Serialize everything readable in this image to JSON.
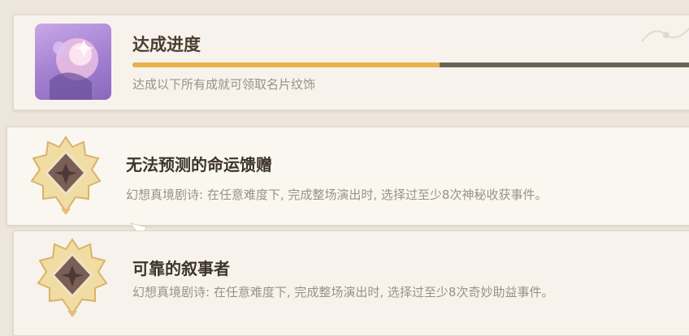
{
  "progress": {
    "title": "达成进度",
    "subtitle": "达成以下所有成就可领取名片纹饰",
    "fraction": 0.54,
    "fill_color": "#e7b24c",
    "track_color": "#6b6357",
    "thumbnail_icon": "namecard-thumbnail"
  },
  "achievements": [
    {
      "title": "无法预测的命运馈赠",
      "description": "幻想真境剧诗: 在任意难度下, 完成整场演出时, 选择过至少8次神秘收获事件。",
      "badge_icon": "achievement-badge-icon"
    },
    {
      "title": "可靠的叙事者",
      "description": "幻想真境剧诗: 在任意难度下, 完成整场演出时, 选择过至少8次奇妙助益事件。",
      "badge_icon": "achievement-badge-icon"
    }
  ],
  "colors": {
    "background": "#ece6dc",
    "card": "#f7f3ec",
    "title_text": "#3e342a",
    "sub_text": "#9a9184",
    "badge_gold": "#e2c07a"
  }
}
